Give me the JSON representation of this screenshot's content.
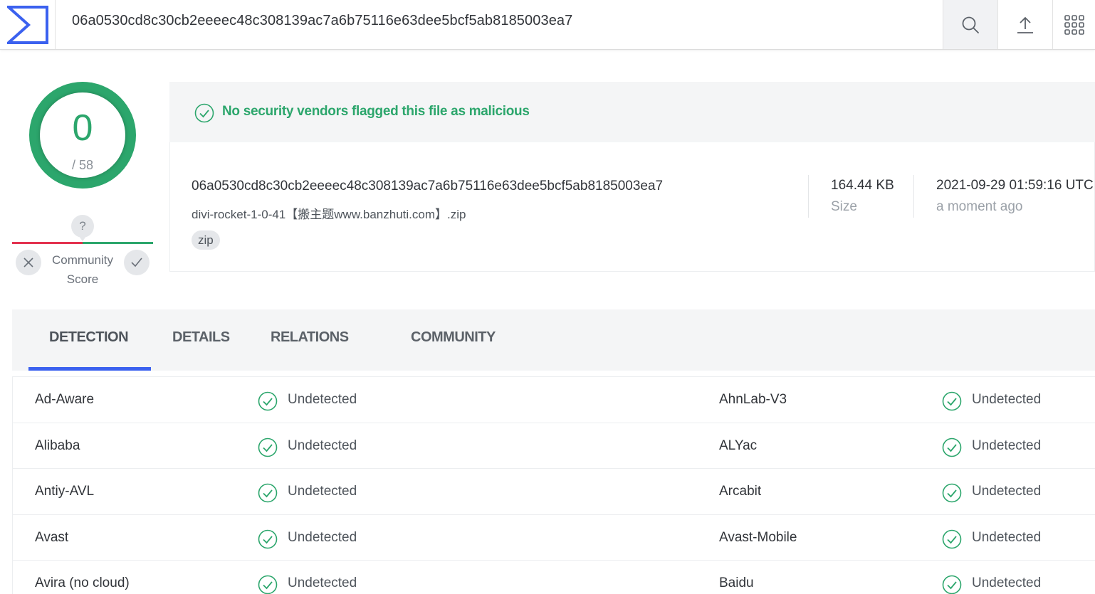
{
  "topbar": {
    "search_value": "06a0530cd8c30cb2eeeec48c308139ac7a6b75116e63dee5bcf5ab8185003ea7"
  },
  "score": {
    "detections": "0",
    "total": "/ 58"
  },
  "community": {
    "question": "?",
    "label": "Community Score"
  },
  "banner": {
    "text": "No security vendors flagged this file as malicious"
  },
  "file": {
    "hash": "06a0530cd8c30cb2eeeec48c308139ac7a6b75116e63dee5bcf5ab8185003ea7",
    "name": "divi-rocket-1-0-41【搬主题www.banzhuti.com】.zip",
    "tag": "zip",
    "size_value": "164.44 KB",
    "size_label": "Size",
    "date_value": "2021-09-29 01:59:16 UTC",
    "date_label": "a moment ago"
  },
  "tabs": [
    "DETECTION",
    "DETAILS",
    "RELATIONS",
    "COMMUNITY"
  ],
  "detections": [
    {
      "left_engine": "Ad-Aware",
      "left_result": "Undetected",
      "right_engine": "AhnLab-V3",
      "right_result": "Undetected"
    },
    {
      "left_engine": "Alibaba",
      "left_result": "Undetected",
      "right_engine": "ALYac",
      "right_result": "Undetected"
    },
    {
      "left_engine": "Antiy-AVL",
      "left_result": "Undetected",
      "right_engine": "Arcabit",
      "right_result": "Undetected"
    },
    {
      "left_engine": "Avast",
      "left_result": "Undetected",
      "right_engine": "Avast-Mobile",
      "right_result": "Undetected"
    },
    {
      "left_engine": "Avira (no cloud)",
      "left_result": "Undetected",
      "right_engine": "Baidu",
      "right_result": "Undetected"
    }
  ],
  "colors": {
    "accent_blue": "#3b61ef",
    "clean_green": "#2ca66c",
    "malicious_red": "#e3324f"
  },
  "icons": {
    "logo": "virustotal-sigma-logo",
    "search": "search-icon",
    "upload": "upload-icon",
    "apps": "apps-grid-icon",
    "clean": "check-circle-icon"
  }
}
